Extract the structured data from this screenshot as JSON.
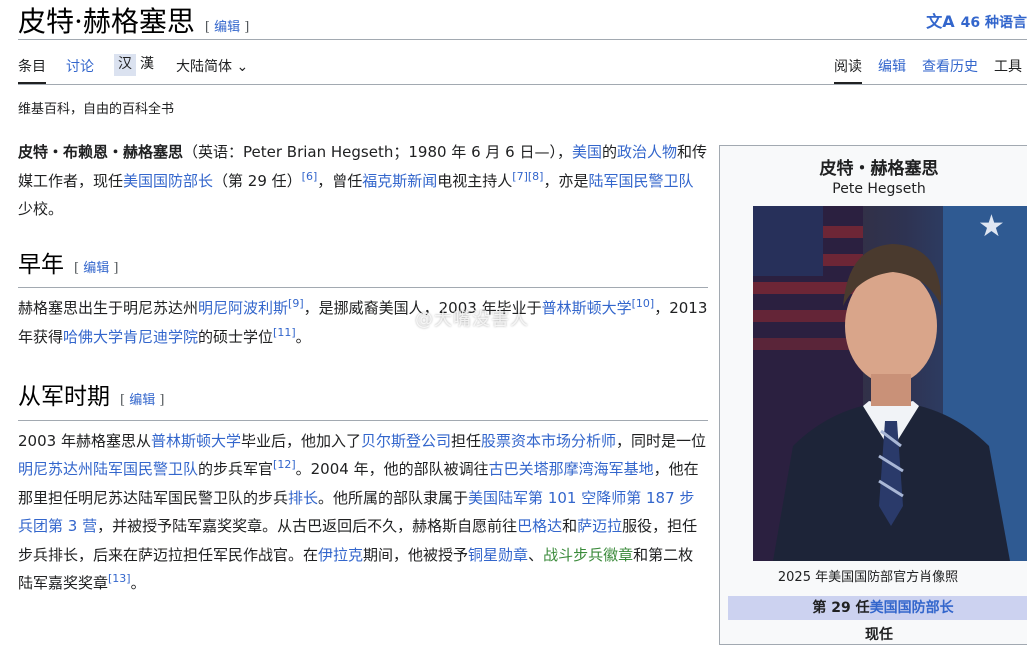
{
  "page": {
    "title": "皮特·赫格塞思",
    "edit_label": "编辑",
    "languages_label": "46 种语言",
    "tagline": "维基百科，自由的百科全书"
  },
  "tabs": {
    "article": "条目",
    "talk": "讨论",
    "variant_simplified": "汉",
    "variant_traditional": "漢",
    "variant_dropdown": "大陆简体",
    "read": "阅读",
    "edit": "编辑",
    "history": "查看历史",
    "tools": "工具"
  },
  "intro": {
    "t1": "皮特・布赖恩・赫格塞思",
    "t2": "（英语：Peter Brian Hegseth；1980 年 6 月 6 日—），",
    "l1": "美国",
    "t3": "的",
    "l2": "政治人物",
    "t4": "和传媒工作者，现任",
    "l3": "美国国防部长",
    "t5": "（第 29 任）",
    "r1": "[6]",
    "t6": "，曾任",
    "l4": "福克斯新闻",
    "t7": "电视主持人",
    "r2": "[7]",
    "r3": "[8]",
    "t8": "，亦是",
    "l5": "陆军国民警卫队",
    "t9": "少校。"
  },
  "early": {
    "heading": "早年",
    "t1": "赫格塞思出生于明尼苏达州",
    "l1": "明尼阿波利斯",
    "r1": "[9]",
    "t2": "，是挪威裔美国人，",
    "t3": "2003 年毕业于",
    "l2": "普林斯顿大学",
    "r2": "[10]",
    "t4": "，2013 年获得",
    "l3": "哈佛大学肯尼迪学院",
    "t5": "的硕士学位",
    "r3": "[11]",
    "t6": "。"
  },
  "military": {
    "heading": "从军时期",
    "t1": "2003 年赫格塞思从",
    "l1": "普林斯顿大学",
    "t2": "毕业后，他加入了",
    "l2": "贝尔斯登公司",
    "t3": "担任",
    "l3": "股票资本市场分析师",
    "t4": "，同时是一位",
    "l4": "明尼苏达州陆军国民警卫队",
    "t5": "的步兵军官",
    "r1": "[12]",
    "t6": "。2004 年，他的部队被调往",
    "l5": "古巴关塔那摩湾海军基地",
    "t7": "，他在那里担任明尼苏达陆军国民警卫队的步兵",
    "l6": "排长",
    "t8": "。他所属的部队隶属于",
    "l7": "美国陆军第 101 空降师第 187 步兵团第 3 营",
    "t9": "，并被授予陆军嘉奖奖章。从古巴返回后不久，赫格斯自愿前往",
    "l8": "巴格达",
    "t10": "和",
    "l9": "萨迈拉",
    "t11": "服役，担任步兵排长，后来在萨迈拉担任军民作战官。在",
    "l10": "伊拉克",
    "t12": "期间，他被授予",
    "l11": "铜星勋章",
    "t13": "、",
    "l12": "战斗步兵徽章",
    "t14": "和第二枚陆军嘉奖奖章",
    "r2": "[13]",
    "t15": "。"
  },
  "infobox": {
    "name": "皮特・赫格塞思",
    "native_name": "Pete Hegseth",
    "caption": "2025 年美国国防部官方肖像照",
    "office_prefix": "第 29 任",
    "office_link": "美国国防部长",
    "status": "现任"
  },
  "watermark": "@大嘴没害人"
}
